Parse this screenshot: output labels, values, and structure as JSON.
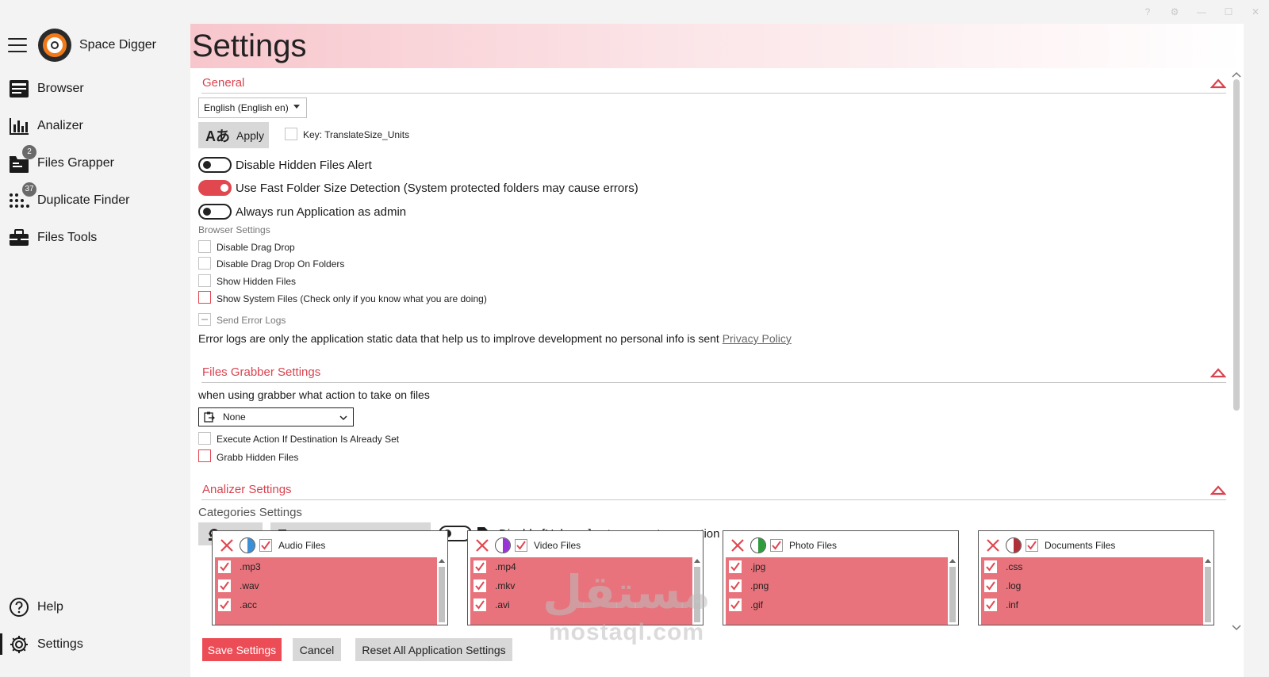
{
  "app": {
    "name": "Space Digger"
  },
  "sidebar": {
    "items": [
      {
        "label": "Browser",
        "icon": "browser-icon"
      },
      {
        "label": "Analizer",
        "icon": "chart-icon"
      },
      {
        "label": "Files Grapper",
        "icon": "files-icon",
        "badge": "2"
      },
      {
        "label": "Duplicate Finder",
        "icon": "dots-grid-icon",
        "badge": "37"
      },
      {
        "label": "Files Tools",
        "icon": "toolbox-icon"
      }
    ],
    "bottom": [
      {
        "label": "Help",
        "icon": "help-icon"
      },
      {
        "label": "Settings",
        "icon": "gear-icon",
        "active": true
      }
    ]
  },
  "page": {
    "title": "Settings"
  },
  "general": {
    "title": "General",
    "language_value": "English (English en)",
    "apply_label": "Apply",
    "translate_key_label": "Key: TranslateSize_Units",
    "toggles": [
      {
        "label": "Disable Hidden Files Alert",
        "on": false
      },
      {
        "label": "Use Fast Folder Size Detection (System protected folders may cause errors)",
        "on": true
      },
      {
        "label": "Always run Application as admin",
        "on": false
      }
    ],
    "browser_settings_label": "Browser Settings",
    "browser_checks": [
      {
        "label": "Disable Drag Drop"
      },
      {
        "label": "Disable Drag Drop On Folders"
      },
      {
        "label": "Show Hidden Files"
      },
      {
        "label": "Show System Files (Check only if you know what you are doing)"
      }
    ],
    "send_error_logs_label": "Send Error Logs",
    "error_logs_text": "Error logs are only the application static data that help us to implrove development no personal info is sent ",
    "privacy_policy_label": "Privacy Policy"
  },
  "grabber": {
    "title": "Files Grabber Settings",
    "description": "when using grabber what action to take on files",
    "action_value": "None",
    "checks": [
      {
        "label": "Execute Action If Destination Is Already Set"
      },
      {
        "label": "Grabb Hidden Files"
      }
    ]
  },
  "analizer": {
    "title": "Analizer Settings",
    "categories_label": "Categories Settings",
    "reset_label": "Reset",
    "new_category_label": "New Extexntion Category",
    "disable_unknown_label": "Disable [Unkown] category auto genration",
    "categories": [
      {
        "title": "Audio Files",
        "color": "#3b8fd6",
        "extensions": [
          ".mp3",
          ".wav",
          ".acc"
        ]
      },
      {
        "title": "Video Files",
        "color": "#9b34d8",
        "extensions": [
          ".mp4",
          ".mkv",
          ".avi"
        ]
      },
      {
        "title": "Photo Files",
        "color": "#2e9c3c",
        "extensions": [
          ".jpg",
          ".png",
          ".gif"
        ]
      },
      {
        "title": "Documents Files",
        "color": "#b0303a",
        "extensions": [
          ".css",
          ".log",
          ".inf"
        ]
      }
    ]
  },
  "footer": {
    "save_label": "Save Settings",
    "cancel_label": "Cancel",
    "reset_all_label": "Reset All Application Settings"
  },
  "watermark": {
    "arabic": "مستقل",
    "latin": "mostaql.com"
  },
  "colors": {
    "accent": "#e0474f",
    "category_row": "#e8737c"
  }
}
